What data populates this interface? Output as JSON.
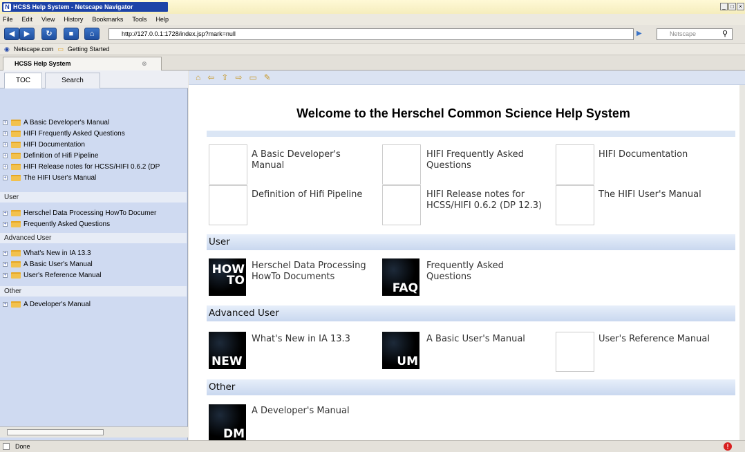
{
  "window": {
    "title": "HCSS Help System - Netscape Navigator"
  },
  "menu": [
    "File",
    "Edit",
    "View",
    "History",
    "Bookmarks",
    "Tools",
    "Help"
  ],
  "nav": {
    "url": "http://127.0.0.1:1728/index.jsp?mark=null",
    "search_placeholder": "Netscape"
  },
  "bookmarks": [
    "Netscape.com",
    "Getting Started"
  ],
  "tab": {
    "title": "HCSS Help System"
  },
  "sidebar": {
    "tabs": [
      "TOC",
      "Search"
    ],
    "items": [
      "A Basic Developer's Manual",
      "HIFI Frequently Asked Questions",
      "HIFI Documentation",
      "Definition of Hifi Pipeline",
      "HIFI Release notes for HCSS/HIFI 0.6.2 (DP",
      "The HIFI User's Manual"
    ],
    "user_label": "User",
    "user_items": [
      "Herschel Data Processing HowTo Documer",
      "Frequently Asked Questions"
    ],
    "advanced_label": "Advanced User",
    "advanced_items": [
      "What's New in IA 13.3",
      "A Basic User's Manual",
      "User's Reference Manual"
    ],
    "other_label": "Other",
    "other_items": [
      "A Developer's Manual"
    ]
  },
  "content": {
    "heading": "Welcome to the Herschel Common Science Help System",
    "top": [
      "A Basic Developer's Manual",
      "HIFI Frequently Asked Questions",
      "HIFI Documentation",
      "Definition of Hifi Pipeline",
      "HIFI Release notes for HCSS/HIFI 0.6.2 (DP 12.3)",
      "The HIFI User's Manual"
    ],
    "user": {
      "title": "User",
      "items": [
        "Herschel Data Processing HowTo Documents",
        "Frequently Asked Questions"
      ],
      "icons": [
        "HOW TO",
        "FAQ"
      ]
    },
    "advanced": {
      "title": "Advanced User",
      "items": [
        "What's New in IA 13.3",
        "A Basic User's Manual",
        "User's Reference Manual"
      ],
      "icons": [
        "NEW",
        "UM"
      ]
    },
    "other": {
      "title": "Other",
      "items": [
        "A Developer's Manual"
      ],
      "icons": [
        "DM"
      ]
    }
  },
  "status": {
    "text": "Done"
  }
}
